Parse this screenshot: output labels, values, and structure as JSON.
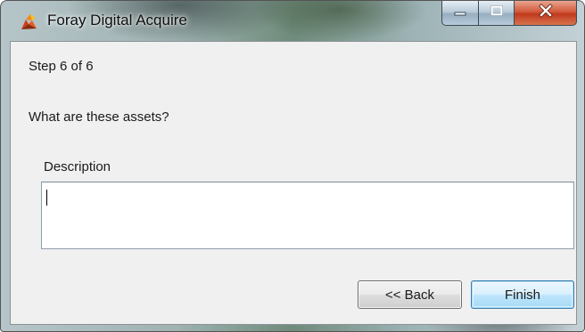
{
  "window": {
    "title": "Foray Digital Acquire",
    "app_icon": "foray-app-icon",
    "caption_buttons": {
      "minimize_icon": "minimize-icon",
      "maximize_icon": "maximize-icon",
      "close_icon": "close-icon"
    }
  },
  "wizard": {
    "step_label": "Step 6 of 6",
    "question": "What are these assets?",
    "description": {
      "label": "Description",
      "value": ""
    }
  },
  "buttons": {
    "back_label": "<< Back",
    "finish_label": "Finish"
  },
  "colors": {
    "client_background": "#f0f0f0",
    "close_button": "#c13a1e",
    "default_button_border": "#3c7fb1"
  }
}
